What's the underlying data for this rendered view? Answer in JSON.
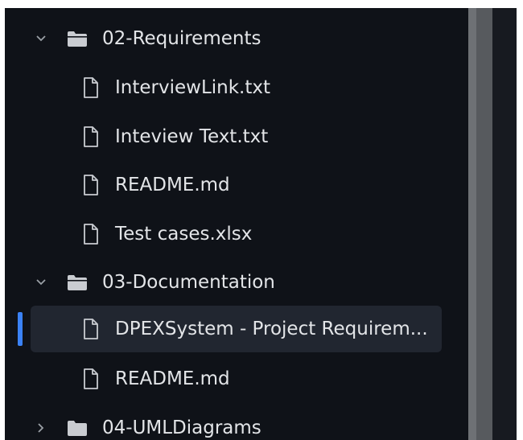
{
  "explorer": {
    "items": [
      {
        "type": "folder",
        "expanded": true,
        "label": "02-Requirements",
        "icon": "folder-open-icon"
      },
      {
        "type": "file",
        "label": "InterviewLink.txt",
        "icon": "file-icon"
      },
      {
        "type": "file",
        "label": "Inteview Text.txt",
        "icon": "file-icon"
      },
      {
        "type": "file",
        "label": "README.md",
        "icon": "file-icon"
      },
      {
        "type": "file",
        "label": "Test cases.xlsx",
        "icon": "file-icon"
      },
      {
        "type": "folder",
        "expanded": true,
        "label": "03-Documentation",
        "icon": "folder-open-icon"
      },
      {
        "type": "file",
        "label": "DPEXSystem - Project Requirem...",
        "icon": "file-icon",
        "selected": true
      },
      {
        "type": "file",
        "label": "README.md",
        "icon": "file-icon"
      },
      {
        "type": "folder",
        "expanded": false,
        "label": "04-UMLDiagrams",
        "icon": "folder-closed-icon"
      }
    ]
  },
  "colors": {
    "panel_bg": "#0f1218",
    "text": "#e3e5e8",
    "icon": "#c9ccd1",
    "selected_bg": "#212630",
    "accent": "#3b82f6",
    "scrollbar": "#575a5e"
  }
}
